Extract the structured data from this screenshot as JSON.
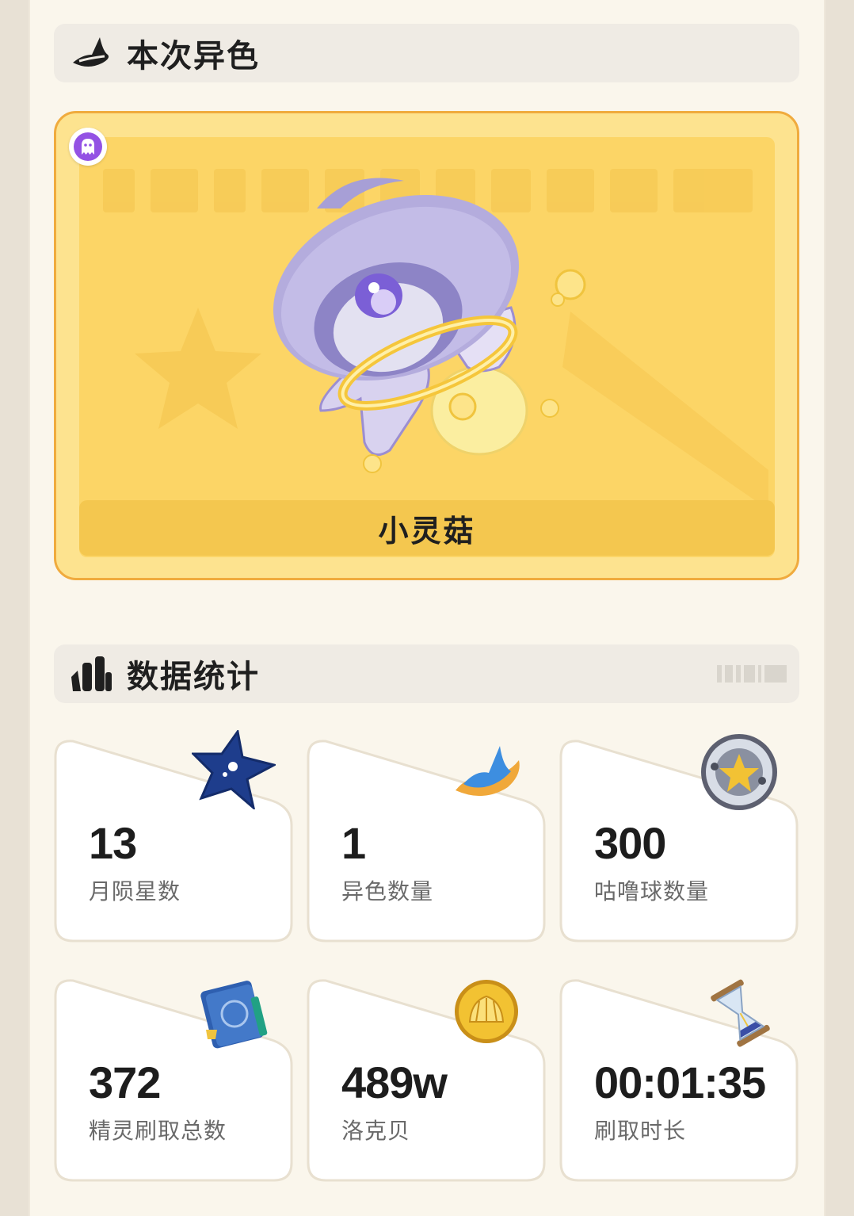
{
  "shiny_section": {
    "title": "本次异色"
  },
  "shiny_card": {
    "pet_name": "小灵菇",
    "type_icon": "ghost-icon",
    "type_color": "#9352e4",
    "card_color": "#fde38f",
    "border_color": "#f0ab3e"
  },
  "stats_section": {
    "title": "数据统计"
  },
  "stats": [
    {
      "value": "13",
      "label": "月陨星数",
      "icon": "star-icon"
    },
    {
      "value": "1",
      "label": "异色数量",
      "icon": "hat-icon"
    },
    {
      "value": "300",
      "label": "咕噜球数量",
      "icon": "ball-icon"
    },
    {
      "value": "372",
      "label": "精灵刷取总数",
      "icon": "book-icon"
    },
    {
      "value": "489w",
      "label": "洛克贝",
      "icon": "coin-icon"
    },
    {
      "value": "00:01:35",
      "label": "刷取时长",
      "icon": "hourglass-icon"
    }
  ]
}
